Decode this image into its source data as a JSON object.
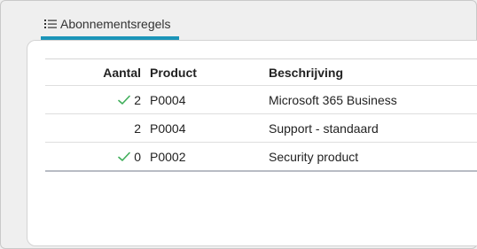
{
  "tab": {
    "label": "Abonnementsregels",
    "icon": "list-icon",
    "accent_color": "#1b95b8"
  },
  "table": {
    "headers": {
      "aantal": "Aantal",
      "product": "Product",
      "beschrijving": "Beschrijving"
    },
    "rows": [
      {
        "checked": true,
        "aantal": "2",
        "product": "P0004",
        "beschrijving": "Microsoft 365 Business"
      },
      {
        "checked": false,
        "aantal": "2",
        "product": "P0004",
        "beschrijving": "Support - standaard"
      },
      {
        "checked": true,
        "aantal": "0",
        "product": "P0002",
        "beschrijving": "Security product"
      }
    ],
    "check_color": "#3fae5a"
  }
}
